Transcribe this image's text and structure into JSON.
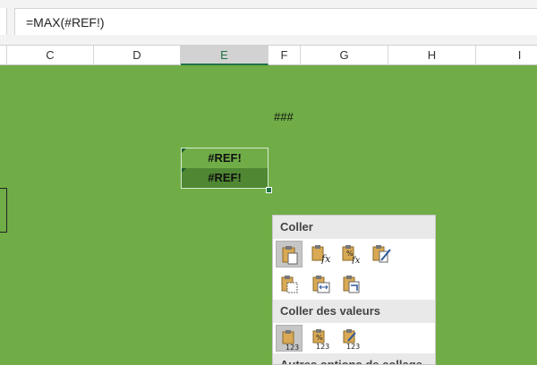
{
  "formula_bar": {
    "content": "=MAX(#REF!)"
  },
  "columns": {
    "c": "C",
    "d": "D",
    "e": "E",
    "f": "F",
    "g": "G",
    "h": "H",
    "i": "I"
  },
  "cells": {
    "f_top": "###",
    "e1": "#REF!",
    "e2": "#REF!"
  },
  "paste_menu": {
    "section_paste": "Coller",
    "section_values": "Coller des valeurs",
    "section_other": "Autres options de collage",
    "paste_icons": [
      "paste-icon",
      "paste-formulas-icon",
      "paste-formulas-number-format-icon",
      "paste-keep-source-formatting-icon",
      "paste-no-borders-icon",
      "paste-keep-column-widths-icon",
      "paste-transpose-icon"
    ],
    "value_icons": [
      "paste-values-icon",
      "paste-values-number-format-icon",
      "paste-values-source-formatting-icon"
    ],
    "badge_123": "123"
  },
  "colors": {
    "grid_green": "#70ad47",
    "selected_dark": "#4f8732",
    "excel_green": "#217346"
  }
}
